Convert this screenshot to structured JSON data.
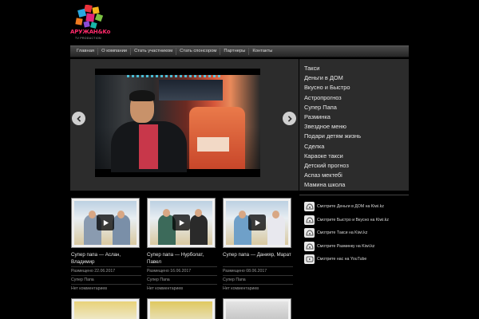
{
  "logo": {
    "name": "АРУЖАН&Ko",
    "sub": "TV PRODUCTION"
  },
  "nav": [
    "Главная",
    "О компании",
    "Стать участником",
    "Стать спонсором",
    "Партнеры",
    "Контакты"
  ],
  "side_menu": [
    "Такси",
    "Деньги в ДОМ",
    "Вкусно и Быстро",
    "Астропрогноз",
    "Супер Папа",
    "Разминка",
    "Звездное меню",
    "Подари детям жизнь",
    "Сделка",
    "Караоке такси",
    "Детский прогноз",
    "Аспаз мектебi",
    "Мамина школа"
  ],
  "cards": [
    {
      "title": "Супер папа — Аслан, Владимир",
      "date": "Размещено 22.06.2017",
      "category": "Супер Папа",
      "comments": "Нет комментариев"
    },
    {
      "title": "Супер папа — Нурболат, Павел",
      "date": "Размещено 16.06.2017",
      "category": "Супер Папа",
      "comments": "Нет комментариев"
    },
    {
      "title": "Супер папа — Данияр, Марат",
      "date": "Размещено 08.06.2017",
      "category": "Супер Папа",
      "comments": "Нет комментариев"
    }
  ],
  "links": [
    "Смотрите Деньги в ДОМ на Kiwi.kz",
    "Смотрите Быстро и Вкусно на Kiwi.kz",
    "Смотрите Такси на Kiwi.kz",
    "Смотрите Разминку на Kiwi.kz",
    "Смотрите нас на YouTube"
  ]
}
